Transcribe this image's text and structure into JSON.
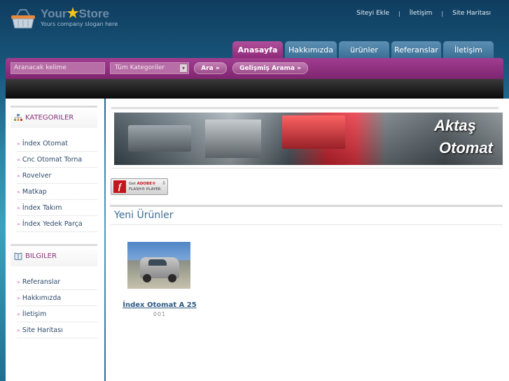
{
  "header": {
    "logo_word1": "Your",
    "logo_word2": "Store",
    "slogan": "Yours company slogan here",
    "toplinks": [
      "Siteyi Ekle",
      "İletişim",
      "Site Haritası"
    ]
  },
  "tabs": [
    {
      "label": "Anasayfa",
      "active": true
    },
    {
      "label": "Hakkımızda",
      "active": false
    },
    {
      "label": "ürünler",
      "active": false
    },
    {
      "label": "Referanslar",
      "active": false
    },
    {
      "label": "İletişim",
      "active": false
    }
  ],
  "search": {
    "placeholder": "Aranacak kelime",
    "category_value": "Tüm Kategoriler",
    "search_button": "Ara »",
    "advanced_button": "Gelişmiş Arama »"
  },
  "sidebar": {
    "categories_title": "KATEGORILER",
    "categories": [
      "İndex Otomat",
      "Cnc Otomat Torna",
      "Rovelver",
      "Matkap",
      "İndex Takım",
      "İndex Yedek Parça"
    ],
    "info_title": "BILGILER",
    "info": [
      "Referanslar",
      "Hakkımızda",
      "İletişim",
      "Site Haritası"
    ]
  },
  "main": {
    "banner_line1": "Aktaş",
    "banner_line2": "Otomat",
    "flash": {
      "line1_prefix": "Get ",
      "line1_brand": "ADOBE®",
      "line2": "FLASH® PLAYER"
    },
    "section_title": "Yeni Ürünler",
    "products": [
      {
        "name": "İndex Otomat A 25",
        "code": "001"
      }
    ]
  },
  "colors": {
    "accent_purple": "#8e2b7a",
    "tab_blue": "#3b6f95",
    "link_blue": "#2f5a85"
  }
}
